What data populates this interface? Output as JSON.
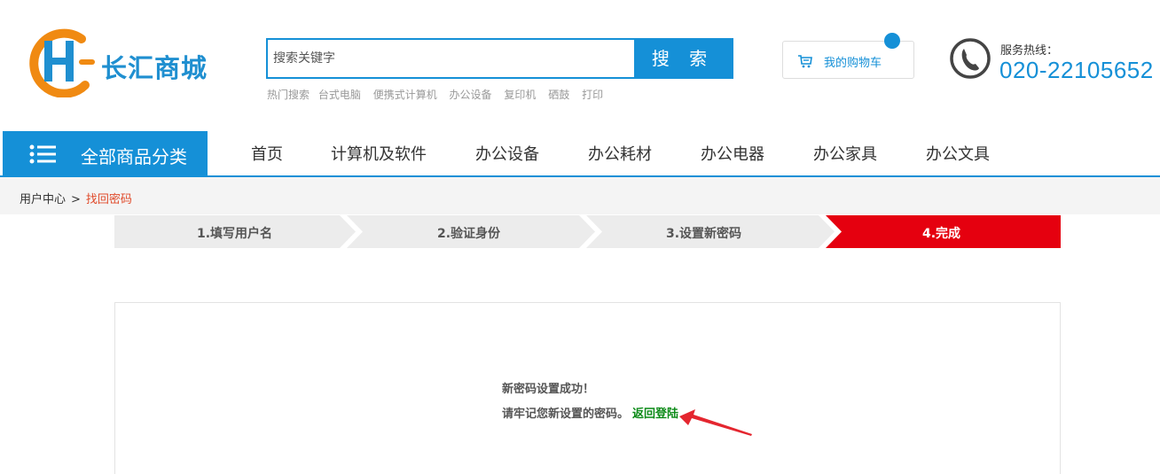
{
  "header": {
    "logo_text": "长汇商城",
    "search_placeholder": "搜索关键字",
    "search_button": "搜 索",
    "hot_label": "热门搜索",
    "hot_items": [
      "台式电脑",
      "便携式计算机",
      "办公设备",
      "复印机",
      "硒鼓",
      "打印"
    ],
    "cart_label": "我的购物车",
    "hotline_label": "服务热线：",
    "hotline_number": "020-22105652"
  },
  "nav": {
    "all_categories": "全部商品分类",
    "items": [
      "首页",
      "计算机及软件",
      "办公设备",
      "办公耗材",
      "办公电器",
      "办公家具",
      "办公文具"
    ]
  },
  "breadcrumb": {
    "parent": "用户中心",
    "separator": ">",
    "current": "找回密码"
  },
  "steps": {
    "items": [
      "1.填写用户名",
      "2.验证身份",
      "3.设置新密码",
      "4.完成"
    ],
    "active_index": 3
  },
  "result": {
    "title": "新密码设置成功！",
    "note": "请牢记您新设置的密码。",
    "back_link": "返回登陆"
  },
  "colors": {
    "brand_blue": "#1590d7",
    "active_step_red": "#e5000f",
    "inactive_step_gray": "#ececec",
    "link_green": "#0b8a17",
    "arrow_red": "#e4262f"
  }
}
